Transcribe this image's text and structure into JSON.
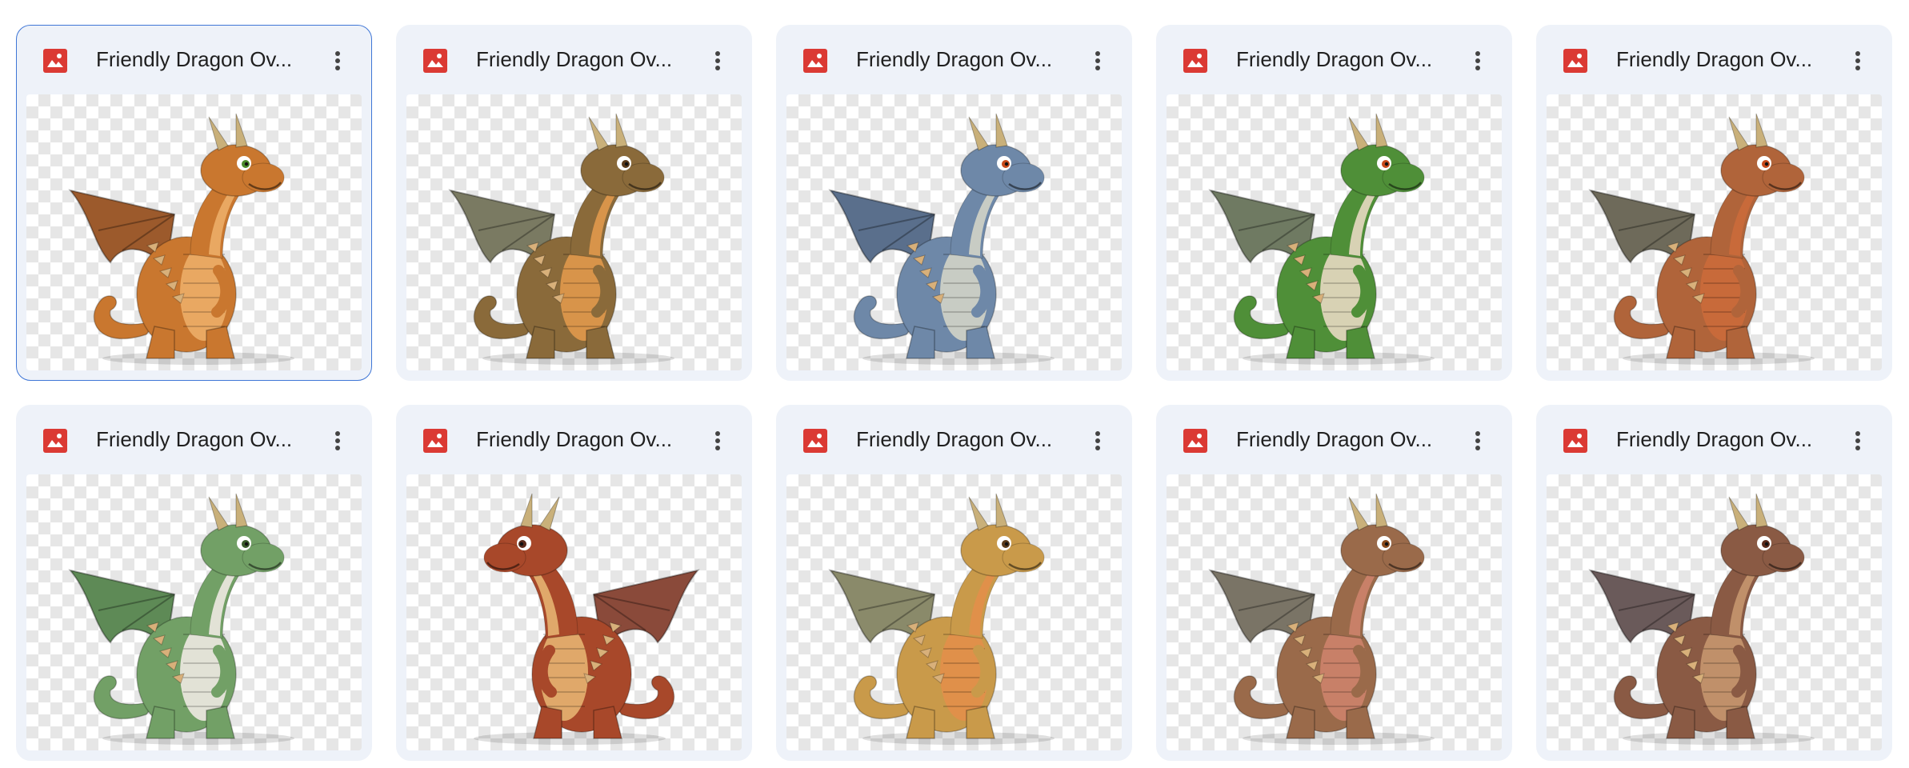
{
  "files": [
    {
      "title": "Friendly Dragon Ov...",
      "type_icon": "image-file-icon",
      "selected": true,
      "body": "#c9772f",
      "belly": "#e9a862",
      "wing": "#9c5a2c",
      "eye": "#4a8a2a",
      "pose": "left"
    },
    {
      "title": "Friendly Dragon Ov...",
      "type_icon": "image-file-icon",
      "selected": false,
      "body": "#8a6a3a",
      "belly": "#d8944a",
      "wing": "#7a7a62",
      "eye": "#5a3a1a",
      "pose": "left"
    },
    {
      "title": "Friendly Dragon Ov...",
      "type_icon": "image-file-icon",
      "selected": false,
      "body": "#6e88a8",
      "belly": "#c8ccc4",
      "wing": "#5a6f8c",
      "eye": "#c84a1a",
      "pose": "left"
    },
    {
      "title": "Friendly Dragon Ov...",
      "type_icon": "image-file-icon",
      "selected": false,
      "body": "#4f8f38",
      "belly": "#d8d2b4",
      "wing": "#6f7a62",
      "eye": "#c84a1a",
      "pose": "left"
    },
    {
      "title": "Friendly Dragon Ov...",
      "type_icon": "image-file-icon",
      "selected": false,
      "body": "#b0643a",
      "belly": "#c86a3a",
      "wing": "#6e6a5a",
      "eye": "#c84a1a",
      "pose": "left"
    },
    {
      "title": "Friendly Dragon Ov...",
      "type_icon": "image-file-icon",
      "selected": false,
      "body": "#72a066",
      "belly": "#e2e2d6",
      "wing": "#5e8a56",
      "eye": "#3a5a2a",
      "pose": "left"
    },
    {
      "title": "Friendly Dragon Ov...",
      "type_icon": "image-file-icon",
      "selected": false,
      "body": "#a8482a",
      "belly": "#e0a86a",
      "wing": "#8a4a3a",
      "eye": "#5a2a1a",
      "pose": "right"
    },
    {
      "title": "Friendly Dragon Ov...",
      "type_icon": "image-file-icon",
      "selected": false,
      "body": "#c99a4a",
      "belly": "#e0904a",
      "wing": "#8a8a6a",
      "eye": "#5a3a1a",
      "pose": "left"
    },
    {
      "title": "Friendly Dragon Ov...",
      "type_icon": "image-file-icon",
      "selected": false,
      "body": "#9a6a4a",
      "belly": "#c88068",
      "wing": "#7a7466",
      "eye": "#8a4a1a",
      "pose": "left"
    },
    {
      "title": "Friendly Dragon Ov...",
      "type_icon": "image-file-icon",
      "selected": false,
      "body": "#8a5a44",
      "belly": "#c0906a",
      "wing": "#6a5a5a",
      "eye": "#5a2a1a",
      "pose": "left"
    }
  ],
  "colors": {
    "card_bg": "#eef2f9",
    "selected_border": "#3f76d6",
    "image_icon_red": "#db3a34",
    "title_text": "#1f1f1f"
  }
}
